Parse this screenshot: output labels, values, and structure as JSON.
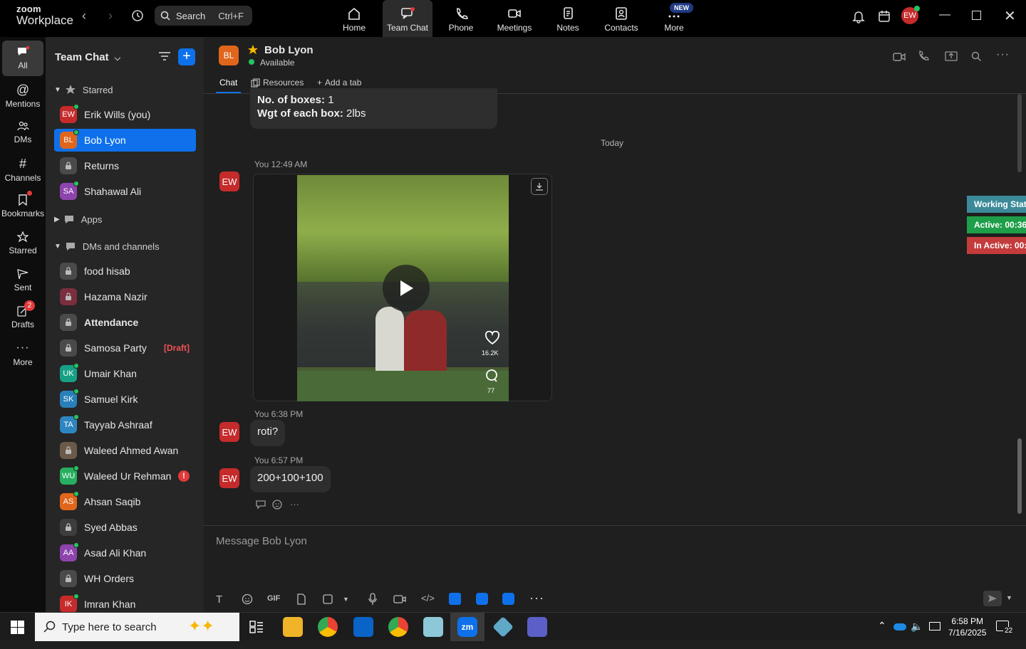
{
  "app": {
    "brand_line1": "zoom",
    "brand_line2": "Workplace"
  },
  "search": {
    "label": "Search",
    "shortcut": "Ctrl+F"
  },
  "topnav": [
    {
      "label": "Home",
      "icon": "home-icon"
    },
    {
      "label": "Team Chat",
      "icon": "chat-icon"
    },
    {
      "label": "Phone",
      "icon": "phone-icon"
    },
    {
      "label": "Meetings",
      "icon": "camera-icon"
    },
    {
      "label": "Notes",
      "icon": "notes-icon"
    },
    {
      "label": "Contacts",
      "icon": "contacts-icon"
    },
    {
      "label": "More",
      "icon": "more-icon",
      "badge": "NEW"
    }
  ],
  "user_avatar": "EW",
  "rail": [
    {
      "label": "All"
    },
    {
      "label": "Mentions"
    },
    {
      "label": "DMs"
    },
    {
      "label": "Channels"
    },
    {
      "label": "Bookmarks"
    },
    {
      "label": "Starred"
    },
    {
      "label": "Sent"
    },
    {
      "label": "Drafts",
      "badge": "2"
    },
    {
      "label": "More"
    }
  ],
  "sidebar": {
    "title": "Team Chat",
    "sections": {
      "starred": "Starred",
      "apps": "Apps",
      "dms": "DMs and channels"
    },
    "starred": [
      {
        "initials": "EW",
        "name": "Erik Wills (you)",
        "color": "#c62b2b"
      },
      {
        "initials": "BL",
        "name": "Bob Lyon",
        "color": "#e0661b"
      },
      {
        "initials": "",
        "name": "Returns",
        "color": "#4a4a4a"
      },
      {
        "initials": "SA",
        "name": "Shahawal Ali",
        "color": "#8e44ad"
      }
    ],
    "dms": [
      {
        "initials": "",
        "name": "food hisab",
        "color": "#4a4a4a"
      },
      {
        "initials": "",
        "name": "Hazama Nazir",
        "color": "#7a2e3e"
      },
      {
        "initials": "",
        "name": "Attendance",
        "color": "#4a4a4a"
      },
      {
        "initials": "",
        "name": "Samosa Party",
        "color": "#4a4a4a",
        "draft": "[Draft]"
      },
      {
        "initials": "UK",
        "name": "Umair Khan",
        "color": "#16a085"
      },
      {
        "initials": "SK",
        "name": "Samuel Kirk",
        "color": "#2980b9"
      },
      {
        "initials": "TA",
        "name": "Tayyab Ashraaf",
        "color": "#2e86c1"
      },
      {
        "initials": "",
        "name": "Waleed Ahmed Awan",
        "color": "#6b5a4a"
      },
      {
        "initials": "WU",
        "name": "Waleed Ur Rehman",
        "color": "#27ae60",
        "alert": "!"
      },
      {
        "initials": "AS",
        "name": "Ahsan Saqib",
        "color": "#e0661b"
      },
      {
        "initials": "",
        "name": "Syed Abbas",
        "color": "#3d3d3d"
      },
      {
        "initials": "AA",
        "name": "Asad Ali Khan",
        "color": "#8e44ad"
      },
      {
        "initials": "",
        "name": "WH Orders",
        "color": "#4a4a4a"
      },
      {
        "initials": "IK",
        "name": "Imran Khan",
        "color": "#c62b2b"
      }
    ]
  },
  "chat": {
    "contact_initials": "BL",
    "contact_name": "Bob Lyon",
    "presence": "Available",
    "tabs": {
      "chat": "Chat",
      "resources": "Resources",
      "add": "Add a tab"
    },
    "prev_line1_label": "No. of boxes:",
    "prev_line1_value": "1",
    "prev_line2_label": "Wgt of each box:",
    "prev_line2_value": "2lbs",
    "divider": "Today",
    "messages": [
      {
        "meta": "You 12:49 AM",
        "avatar": "EW",
        "likes": "16.2K",
        "comments": "77"
      },
      {
        "meta": "You 6:38 PM",
        "avatar": "EW",
        "text": "roti?"
      },
      {
        "meta": "You 6:57 PM",
        "avatar": "EW",
        "text": "200+100+100"
      }
    ],
    "placeholder": "Message Bob Lyon",
    "gif_label": "GIF"
  },
  "status_panel": {
    "working": "Working Stat",
    "active": "Active: 00:36",
    "inactive": "In Active: 00:"
  },
  "colors": {
    "accent": "#0e71eb",
    "working": "#3b8a9a",
    "active": "#1e9e49",
    "inactive": "#c43b3b"
  },
  "taskbar": {
    "search_placeholder": "Type here to search",
    "time": "6:58 PM",
    "date": "7/16/2025",
    "notif_count": "22"
  }
}
